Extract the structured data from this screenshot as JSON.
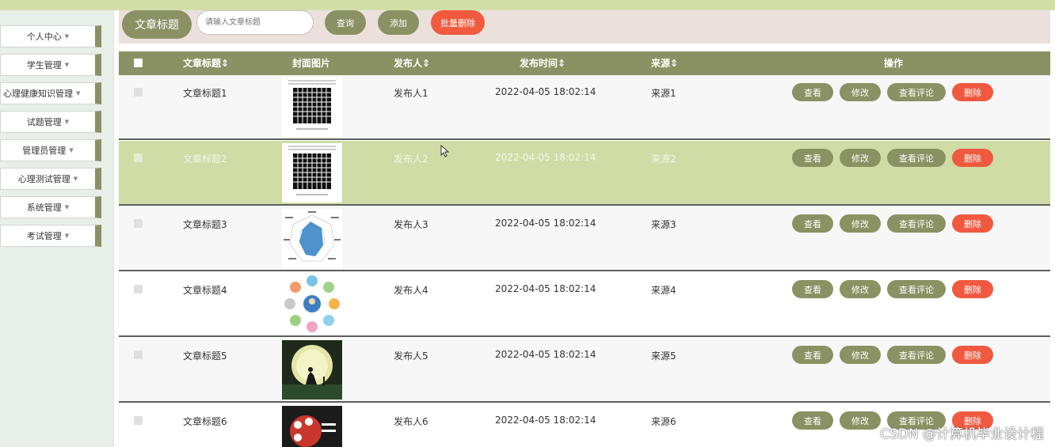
{
  "sidebar": {
    "items": [
      {
        "label": "个人中心"
      },
      {
        "label": "学生管理"
      },
      {
        "label": "心理健康知识管理"
      },
      {
        "label": "试题管理"
      },
      {
        "label": "管理员管理"
      },
      {
        "label": "心理测试管理"
      },
      {
        "label": "系统管理"
      },
      {
        "label": "考试管理"
      }
    ]
  },
  "toolbar": {
    "field_label": "文章标题",
    "search_placeholder": "请输入文章标题",
    "query_label": "查询",
    "add_label": "添加",
    "batch_delete_label": "批量删除"
  },
  "table": {
    "headers": {
      "title": "文章标题",
      "cover": "封面图片",
      "publisher": "发布人",
      "time": "发布时间",
      "source": "来源",
      "actions": "操作"
    },
    "actions": {
      "view": "查看",
      "edit": "修改",
      "comments": "查看评论",
      "delete": "删除"
    },
    "rows": [
      {
        "title": "文章标题1",
        "publisher": "发布人1",
        "time": "2022-04-05 18:02:14",
        "source": "来源1",
        "cover_icon": "grid-image"
      },
      {
        "title": "文章标题2",
        "publisher": "发布人2",
        "time": "2022-04-05 18:02:14",
        "source": "来源2",
        "cover_icon": "grid-image"
      },
      {
        "title": "文章标题3",
        "publisher": "发布人3",
        "time": "2022-04-05 18:02:14",
        "source": "来源3",
        "cover_icon": "radar-chart-image"
      },
      {
        "title": "文章标题4",
        "publisher": "发布人4",
        "time": "2022-04-05 18:02:14",
        "source": "来源4",
        "cover_icon": "emotion-circle-image"
      },
      {
        "title": "文章标题5",
        "publisher": "发布人5",
        "time": "2022-04-05 18:02:14",
        "source": "来源5",
        "cover_icon": "moon-night-image"
      },
      {
        "title": "文章标题6",
        "publisher": "发布人6",
        "time": "2022-04-05 18:02:14",
        "source": "来源6",
        "cover_icon": "psych-test-image"
      }
    ]
  },
  "watermark": "CSDN @计算机毕业设计程",
  "colors": {
    "accent": "#8a9162",
    "highlight_row": "#cfdca6",
    "delete": "#f0593f",
    "batch_delete": "#f15a3e",
    "topbar": "#d2dea8"
  }
}
